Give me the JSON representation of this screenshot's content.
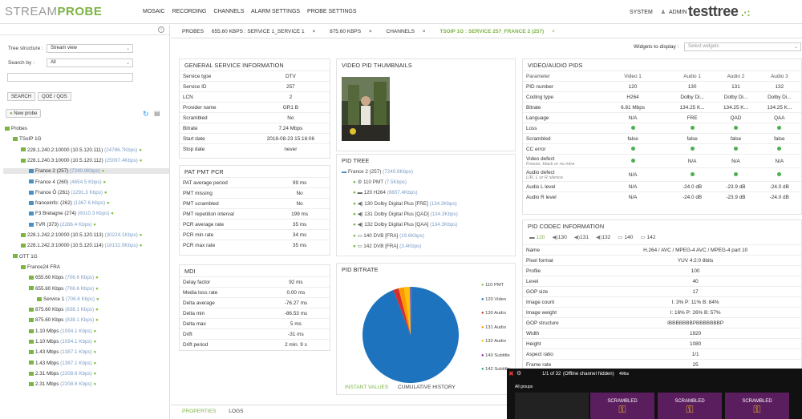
{
  "topbar": {
    "logo_a": "STREAM",
    "logo_b": "PROBE",
    "nav": [
      "MOSAIC",
      "RECORDING",
      "CHANNELS",
      "ALARM SETTINGS",
      "PROBE SETTINGS"
    ],
    "system": "SYSTEM",
    "admin": "ADMIN",
    "brand": "testtree"
  },
  "left": {
    "tree_structure_label": "Tree structure :",
    "tree_structure_value": "Stream view",
    "search_by_label": "Search by :",
    "search_by_value": "All",
    "search_btn": "SEARCH",
    "qoe_btn": "QOE / QOS",
    "new_probe": "New probe",
    "tree": [
      {
        "t": "Probes",
        "k": "",
        "lvl": 0
      },
      {
        "t": "TSoIP 1G",
        "k": "",
        "lvl": 1
      },
      {
        "t": "228.1.240.2:10000 (10.5.120.111)",
        "k": "(24786.7Kbps)",
        "lvl": 2
      },
      {
        "t": "228.1.240.3:10000 (10.5.120.112)",
        "k": "(25097.4Kbps)",
        "lvl": 2
      },
      {
        "t": "France 2 (257)",
        "k": "(7240.9Kbps)",
        "lvl": 3,
        "sel": true
      },
      {
        "t": "France 4 (260)",
        "k": "(4654.5 Kbps)",
        "lvl": 3
      },
      {
        "t": "France Ô (261)",
        "k": "(1291.3 Kbps)",
        "lvl": 3
      },
      {
        "t": "franceinfo: (262)",
        "k": "(1367.6 Kbps)",
        "lvl": 3
      },
      {
        "t": "F3 Bretagne (274)",
        "k": "(6010.3 Kbps)",
        "lvl": 3
      },
      {
        "t": "TVR (373)",
        "k": "(2286.4 Kbps)",
        "lvl": 3
      },
      {
        "t": "228.1.242.2:10000 (10.5.120.113)",
        "k": "(30224.1Kbps)",
        "lvl": 2
      },
      {
        "t": "228.1.242.3:10000 (10.5.120.114)",
        "k": "(18132.9Kbps)",
        "lvl": 2
      },
      {
        "t": "OTT 1G",
        "k": "",
        "lvl": 1
      },
      {
        "t": "France24 FRA",
        "k": "",
        "lvl": 2
      },
      {
        "t": "655.60 Kbps",
        "k": "(706.6 Kbps)",
        "lvl": 3
      },
      {
        "t": "655.60 Kbps",
        "k": "(706.6 Kbps)",
        "lvl": 3
      },
      {
        "t": "Service 1",
        "k": "(706.6 Kbps)",
        "lvl": 4
      },
      {
        "t": "875.60 Kbps",
        "k": "(838.1 Kbps)",
        "lvl": 3
      },
      {
        "t": "875.60 Kbps",
        "k": "(838.1 Kbps)",
        "lvl": 3
      },
      {
        "t": "1.10 Mbps",
        "k": "(1094.1 Kbps)",
        "lvl": 3
      },
      {
        "t": "1.10 Mbps",
        "k": "(1094.1 Kbps)",
        "lvl": 3
      },
      {
        "t": "1.43 Mbps",
        "k": "(1387.1 Kbps)",
        "lvl": 3
      },
      {
        "t": "1.43 Mbps",
        "k": "(1387.1 Kbps)",
        "lvl": 3
      },
      {
        "t": "2.31 Mbps",
        "k": "(2208.6 Kbps)",
        "lvl": 3
      },
      {
        "t": "2.31 Mbps",
        "k": "(2208.6 Kbps)",
        "lvl": 3
      }
    ]
  },
  "tabs": [
    "PROBES",
    "655.60 KBPS : SERVICE 1_SERVICE 1",
    "875.60 KBPS",
    "CHANNELS",
    "TSOIP 1G : SERVICE 257_FRANCE 2 (257)"
  ],
  "widgets": {
    "label": "Widgets to display :",
    "placeholder": "Select widgets"
  },
  "gsi": {
    "title": "GENERAL SERVICE INFORMATION",
    "rows": [
      [
        "Service type",
        "DTV"
      ],
      [
        "Service ID",
        "257"
      ],
      [
        "LCN",
        "2"
      ],
      [
        "Provider name",
        "GR1 B"
      ],
      [
        "Scrambled",
        "No"
      ],
      [
        "Bitrate",
        "7.24 Mbps"
      ],
      [
        "Start date",
        "2018-08-23 15:16:06"
      ],
      [
        "Stop date",
        "never"
      ]
    ]
  },
  "pat": {
    "title": "PAT PMT PCR",
    "rows": [
      [
        "PAT average period",
        "99 ms"
      ],
      [
        "PMT missing",
        "No"
      ],
      [
        "PMT scrambled",
        "No"
      ],
      [
        "PMT repetition interval",
        "199 ms"
      ],
      [
        "PCR average rate",
        "35 ms"
      ],
      [
        "PCR min rate",
        "34 ms"
      ],
      [
        "PCR max rate",
        "35 ms"
      ]
    ]
  },
  "mdi": {
    "title": "MDI",
    "rows": [
      [
        "Delay factor",
        "92 ms"
      ],
      [
        "Media loss rate",
        "0.00 ms"
      ],
      [
        "Delta average",
        "-76.27 ms"
      ],
      [
        "Delta min",
        "-86.53 ms"
      ],
      [
        "Delta max",
        "5 ms"
      ],
      [
        "Drift",
        "-31 ms"
      ],
      [
        "Drift period",
        "2 min. 9 s"
      ]
    ]
  },
  "thumbs": {
    "title": "VIDEO PID THUMBNAILS"
  },
  "pidtree": {
    "title": "PID TREE",
    "root": "France 2 (257)",
    "root_k": "(7240.9Kbps)",
    "items": [
      [
        "110 PMT",
        "(7.5Kbps)"
      ],
      [
        "120 H264",
        "(6807.4Kbps)"
      ],
      [
        "130 Dolby Digital Plus [FRE]",
        "(134.3Kbps)"
      ],
      [
        "131 Dolby Digital Plus [QAD]",
        "(134.3Kbps)"
      ],
      [
        "132 Dolby Digital Plus [QAA]",
        "(134.3Kbps)"
      ],
      [
        "140 DVB [FRA]",
        "(19.6Kbps)"
      ],
      [
        "142 DVB [FRA]",
        "(3.4Kbps)"
      ]
    ]
  },
  "bitrate": {
    "title": "PID BITRATE",
    "tab1": "INSTANT VALUES",
    "tab2": "CUMULATIVE HISTORY"
  },
  "chart_data": {
    "type": "pie",
    "categories": [
      "110 PMT",
      "120 Video",
      "130 Audio",
      "131 Audio",
      "132 Audio",
      "140 Subtitle",
      "142 Subtitle"
    ],
    "values": [
      7.5,
      6807.4,
      134.3,
      134.3,
      134.3,
      19.6,
      3.4
    ],
    "colors": [
      "#8bc34a",
      "#1e73be",
      "#d32f2f",
      "#ff9800",
      "#ffc107",
      "#9c27b0",
      "#26a69a"
    ]
  },
  "vapids": {
    "title": "VIDEO/AUDIO PIDS",
    "head": [
      "Parameter",
      "Video 1",
      "Audio 1",
      "Audio 2",
      "Audio 3"
    ],
    "rows": [
      [
        "PID number",
        "120",
        "130",
        "131",
        "132"
      ],
      [
        "Coding type",
        "H264",
        "Dolby Di...",
        "Dolby Di...",
        "Dolby Di..."
      ],
      [
        "Bitrate",
        "6.81 Mbps",
        "134.25 K...",
        "134.25 K...",
        "134.25 K..."
      ],
      [
        "Language",
        "N/A",
        "FRE",
        "QAD",
        "QAA"
      ],
      [
        "Loss",
        "•",
        "•",
        "•",
        "•"
      ],
      [
        "Scrambled",
        "false",
        "false",
        "false",
        "false"
      ],
      [
        "CC error",
        "•",
        "•",
        "•",
        "•"
      ],
      [
        "Video defect|Freeze, black or no intra",
        "•",
        "N/A",
        "N/A",
        "N/A"
      ],
      [
        "Audio defect|L/R, L or R silence",
        "N/A",
        "•",
        "•",
        "•"
      ],
      [
        "Audio L level",
        "N/A",
        "-24.0 dB",
        "-23.9 dB",
        "-24.0 dB"
      ],
      [
        "Audio R level",
        "N/A",
        "-24.0 dB",
        "-23.9 dB",
        "-24.0 dB"
      ]
    ]
  },
  "codec": {
    "title": "PID CODEC INFORMATION",
    "tabs": [
      "120",
      "130",
      "131",
      "132",
      "140",
      "142"
    ],
    "rows": [
      [
        "Name",
        "H.264 / AVC / MPEG-4 AVC / MPEG-4 part 10"
      ],
      [
        "Pixel format",
        "YUV 4:2:0 8bits"
      ],
      [
        "Profile",
        "100"
      ],
      [
        "Level",
        "40"
      ],
      [
        "GOP size",
        "17"
      ],
      [
        "Image count",
        "I: 3% P: 11% B: 84%"
      ],
      [
        "Image weight",
        "I: 16% P: 26% B: 57%"
      ],
      [
        "GOP structure",
        "IBBBBBBBPBBBBBBBP"
      ],
      [
        "Width",
        "1920"
      ],
      [
        "Height",
        "1080"
      ],
      [
        "Aspect ratio",
        "1/1"
      ],
      [
        "Frame rate",
        "25"
      ]
    ]
  },
  "bottom": {
    "t1": "PROPERTIES",
    "t2": "LOGS"
  },
  "overlay": {
    "pager": "1/1 of 32",
    "note": "(Offline channel hidden)",
    "extra": "4Mbs",
    "group": "All groups",
    "scr1": "SCRAMBLED",
    "scr2": "SCRAMBLED",
    "scr3": "SCRAMBLED"
  }
}
